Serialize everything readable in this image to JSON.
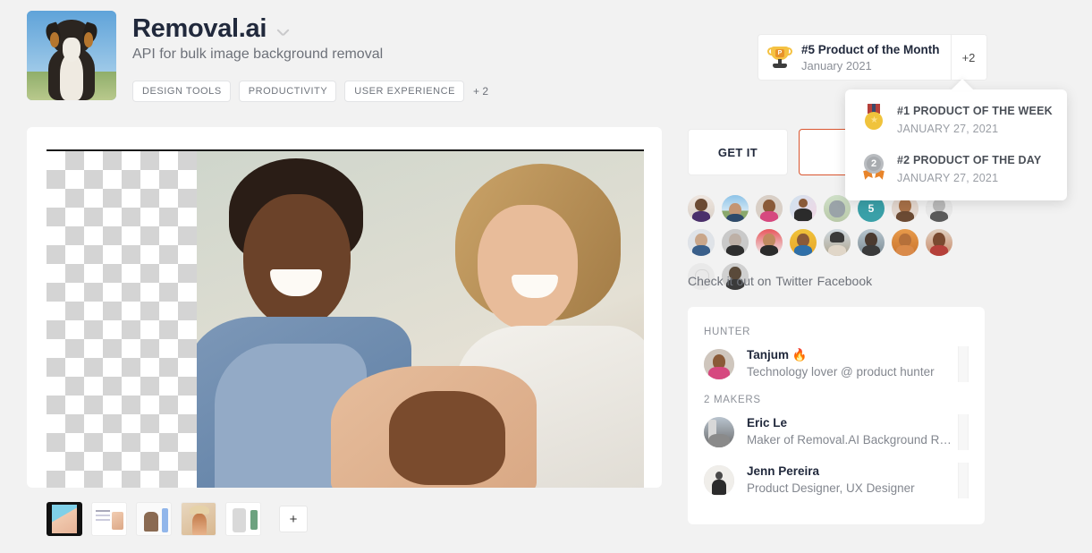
{
  "product": {
    "title": "Removal.ai",
    "tagline": "API for bulk image background removal",
    "tags": [
      "DESIGN TOOLS",
      "PRODUCTIVITY",
      "USER EXPERIENCE"
    ],
    "tags_more": "+ 2"
  },
  "badge": {
    "icon": "trophy-icon",
    "title": "#5 Product of the Month",
    "subtitle": "January 2021",
    "more_label": "+2"
  },
  "badge_tooltip": {
    "items": [
      {
        "icon": "gold-medal-icon",
        "title": "#1 PRODUCT OF THE WEEK",
        "date": "JANUARY 27, 2021"
      },
      {
        "icon": "silver-medal-icon",
        "title": "#2 PRODUCT OF THE DAY",
        "date": "JANUARY 27, 2021"
      }
    ]
  },
  "actions": {
    "get_it_label": "GET IT",
    "upvote_icon": "upvote-caret-icon"
  },
  "avatars": {
    "count_badge": "5",
    "row1": [
      "user-1",
      "user-2",
      "user-3",
      "user-4",
      "user-5",
      "count",
      "user-7",
      "user-8",
      "user-9"
    ],
    "row2": [
      "user-10",
      "user-11",
      "user-12",
      "user-13",
      "user-14",
      "user-15",
      "user-16",
      "ghost",
      "user-18"
    ]
  },
  "share": {
    "prefix": "Check it out on",
    "links": [
      "Twitter",
      "Facebook"
    ]
  },
  "people": {
    "hunter_label": "HUNTER",
    "makers_label": "2 MAKERS",
    "hunter": {
      "name": "Tanjum 🔥",
      "bio": "Technology lover @ product hunter"
    },
    "makers": [
      {
        "name": "Eric Le",
        "bio": "Maker of Removal.AI Background Re..."
      },
      {
        "name": "Jenn Pereira",
        "bio": "Product Designer, UX Designer"
      }
    ]
  },
  "gallery": {
    "thumbnails": [
      "thumb-1",
      "thumb-2",
      "thumb-3",
      "thumb-4",
      "thumb-5"
    ],
    "add_label": "+"
  },
  "colors": {
    "accent": "#da552f",
    "background": "#f2f2f2",
    "text": "#21293c",
    "muted": "#6d7179"
  }
}
